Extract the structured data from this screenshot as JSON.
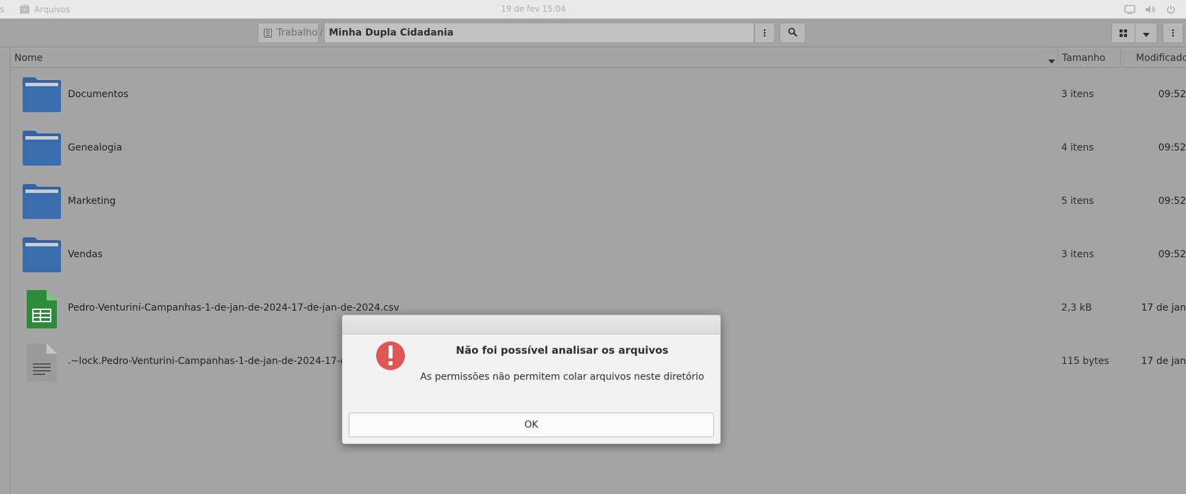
{
  "top_panel": {
    "activities_label": "s",
    "app_name": "Arquivos",
    "clock": "19 de fev  15:04",
    "tray_icons": [
      "display-icon",
      "volume-icon",
      "power-icon"
    ]
  },
  "header": {
    "breadcrumb_home": "Trabalho",
    "breadcrumb_separator": "/",
    "current_folder": "Minha Dupla Cidadania",
    "icons": {
      "path_menu": "vertical-dots-icon",
      "search": "search-icon",
      "view_grid": "grid-view-icon",
      "view_dropdown": "chevron-down-icon",
      "main_menu": "vertical-dots-icon"
    }
  },
  "columns": {
    "name": "Nome",
    "size": "Tamanho",
    "modified": "Modificado"
  },
  "files": [
    {
      "name": "Documentos",
      "size": "3 itens",
      "modified": "09:52",
      "type": "folder"
    },
    {
      "name": "Genealogia",
      "size": "4 itens",
      "modified": "09:52",
      "type": "folder"
    },
    {
      "name": "Marketing",
      "size": "5 itens",
      "modified": "09:52",
      "type": "folder"
    },
    {
      "name": "Vendas",
      "size": "3 itens",
      "modified": "09:52",
      "type": "folder"
    },
    {
      "name": "Pedro-Venturini-Campanhas-1-de-jan-de-2024-17-de-jan-de-2024.csv",
      "size": "2,3 kB",
      "modified": "17 de jan",
      "type": "spreadsheet"
    },
    {
      "name": ".~lock.Pedro-Venturini-Campanhas-1-de-jan-de-2024-17-de-jan-de-2024.csv#",
      "size": "115 bytes",
      "modified": "17 de jan",
      "type": "text"
    }
  ],
  "dialog": {
    "icon": "error-icon",
    "heading": "Não foi possível analisar os arquivos",
    "message": "As permissões não permitem colar arquivos neste diretório",
    "ok_label": "OK"
  },
  "colors": {
    "folder_blue": "#3b68a8",
    "spreadsheet_green": "#2e8b3a",
    "error_red": "#e05555"
  }
}
